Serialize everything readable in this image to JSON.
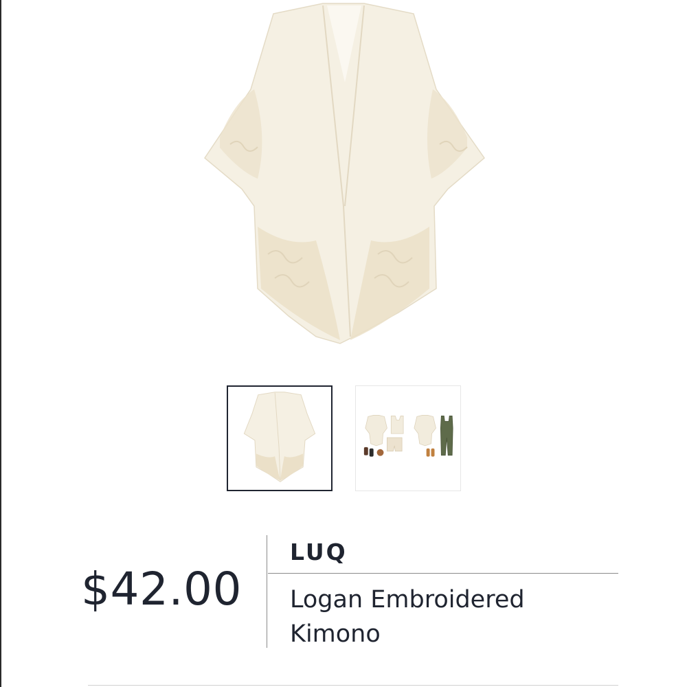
{
  "product": {
    "brand": "LUQ",
    "name": "Logan Embroidered Kimono",
    "price": "$42.00"
  },
  "gallery": {
    "main_image": "white lace kimono",
    "thumbnails": [
      {
        "label": "kimono front view",
        "selected": true
      },
      {
        "label": "styled outfit view",
        "selected": false
      }
    ]
  },
  "colors": {
    "text": "#1f2430",
    "garment": "#f4efe2",
    "lace": "#e9dfc8",
    "divider": "#8a8a8a"
  }
}
